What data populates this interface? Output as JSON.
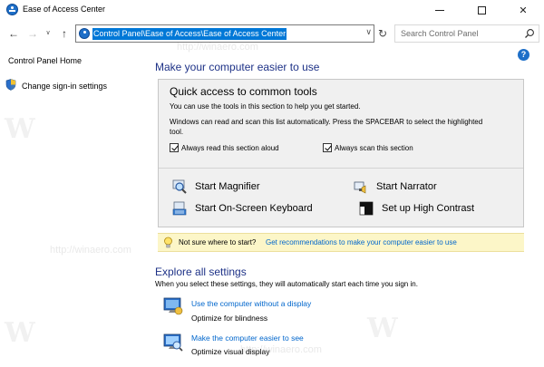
{
  "window": {
    "title": "Ease of Access Center",
    "controls": {
      "minimize": "minimize-icon",
      "maximize": "maximize-icon",
      "close": "✕"
    }
  },
  "toolbar": {
    "back": "←",
    "forward": "→",
    "recent": "∨",
    "up": "↑",
    "address": "Control Panel\\Ease of Access\\Ease of Access Center",
    "address_dropdown": "∨",
    "refresh": "↻",
    "search_placeholder": "Search Control Panel"
  },
  "help": "?",
  "left_pane": {
    "home": "Control Panel Home",
    "signin": "Change sign-in settings"
  },
  "main": {
    "title": "Make your computer easier to use",
    "quick_access": {
      "heading": "Quick access to common tools",
      "desc1": "You can use the tools in this section to help you get started.",
      "desc2": "Windows can read and scan this list automatically.  Press the SPACEBAR to select the highlighted tool.",
      "check_read": "Always read this section aloud",
      "check_scan": "Always scan this section",
      "tools": {
        "magnifier": "Start Magnifier",
        "narrator": "Start Narrator",
        "keyboard": "Start On-Screen Keyboard",
        "contrast": "Set up High Contrast"
      }
    },
    "tip": {
      "text": "Not sure where to start?",
      "link": "Get recommendations to make your computer easier to use"
    },
    "explore": {
      "title": "Explore all settings",
      "desc": "When you select these settings, they will automatically start each time you sign in.",
      "items": [
        {
          "link": "Use the computer without a display",
          "sub": "Optimize for blindness"
        },
        {
          "link": "Make the computer easier to see",
          "sub": "Optimize visual display"
        }
      ]
    }
  },
  "watermark": {
    "text": "http://winaero.com"
  },
  "colors": {
    "accent": "#0078d7",
    "heading": "#1e3287",
    "link": "#0066cc",
    "tip_bg": "#fcf6c8"
  }
}
